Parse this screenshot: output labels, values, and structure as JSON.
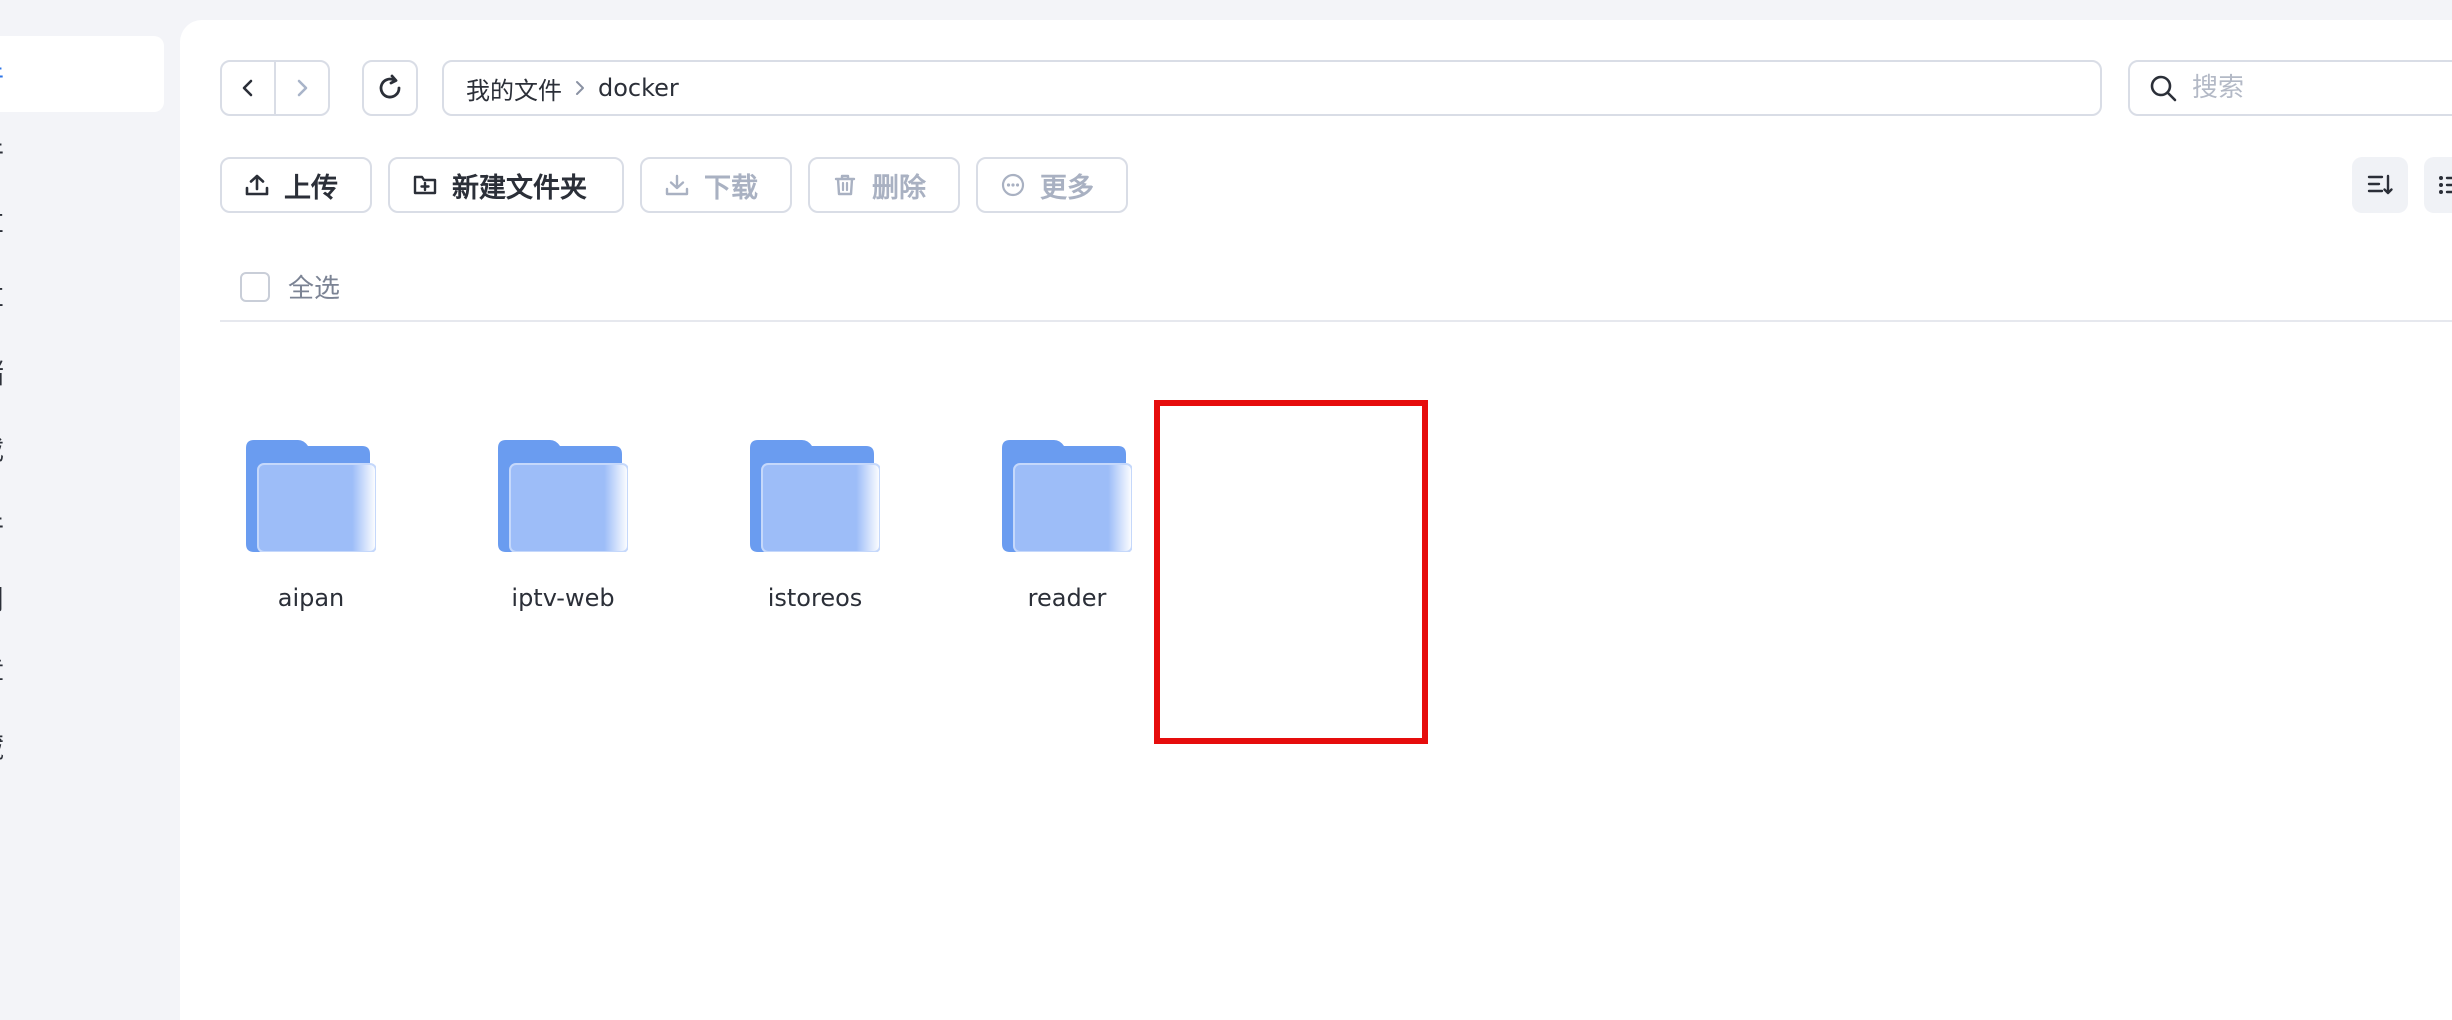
{
  "sidebar": {
    "items": [
      {
        "label": "件",
        "active": true
      },
      {
        "label": "件",
        "active": false
      },
      {
        "label": "共享",
        "active": false
      },
      {
        "label": "共享",
        "active": false
      },
      {
        "label": "储",
        "active": false
      },
      {
        "label": "载",
        "active": false
      },
      {
        "label": "件",
        "active": false
      },
      {
        "label": "问",
        "active": false
      },
      {
        "label": "章",
        "active": false
      },
      {
        "label": "藏",
        "active": false
      }
    ]
  },
  "breadcrumb": {
    "root": "我的文件",
    "current": "docker"
  },
  "search": {
    "placeholder": "搜索"
  },
  "toolbar": {
    "upload_label": "上传",
    "new_folder_label": "新建文件夹",
    "download_label": "下载",
    "delete_label": "删除",
    "more_label": "更多"
  },
  "select_all_label": "全选",
  "folders": [
    {
      "name": "aipan"
    },
    {
      "name": "iptv-web"
    },
    {
      "name": "istoreos"
    },
    {
      "name": "reader"
    }
  ],
  "colors": {
    "accent": "#2f76e8",
    "folder_back": "#6a9cf0",
    "folder_front": "#9dbdf8",
    "highlight": "#e60d0d"
  },
  "icons": {
    "back": "chevron-left-icon",
    "forward": "chevron-right-icon",
    "refresh": "refresh-icon",
    "search": "search-icon",
    "upload": "upload-icon",
    "new_folder": "folder-plus-icon",
    "download": "download-icon",
    "delete": "trash-icon",
    "more": "more-circle-icon",
    "sort": "sort-icon",
    "view": "list-view-icon",
    "folder": "folder-icon"
  }
}
